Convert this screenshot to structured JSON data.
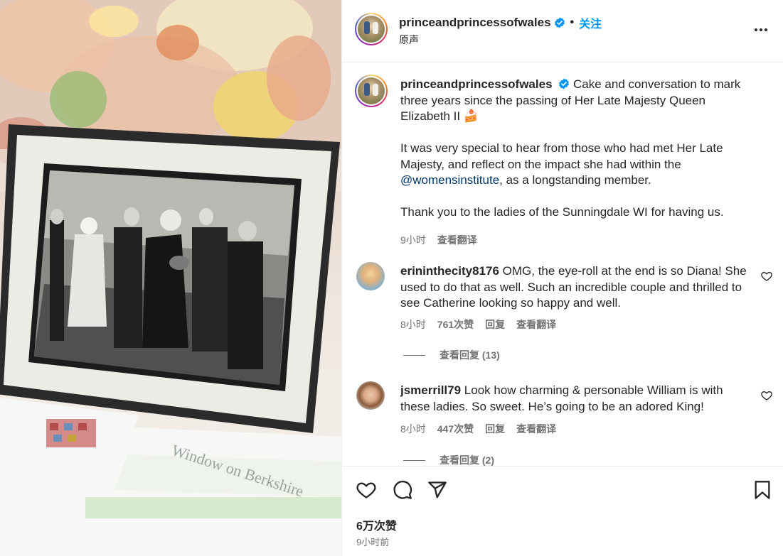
{
  "header": {
    "username": "princeandprincessofwales",
    "separator": "•",
    "follow_label": "关注",
    "subtitle": "原声"
  },
  "caption": {
    "username": "princeandprincessofwales",
    "text_1": "Cake and conversation to mark three years since the passing of Her Late Majesty Queen Elizabeth II 🍰",
    "text_2a": "It was very special to hear from those who had met Her Late Majesty, and reflect on the impact she had within the ",
    "mention": "@womensinstitute",
    "text_2b": ", as a longstanding member.",
    "text_3": "Thank you to the ladies of the Sunningdale WI for having us.",
    "time": "9小时",
    "translate_label": "查看翻译"
  },
  "comments": [
    {
      "username": "erininthecity8176",
      "text": "OMG, the eye-roll at the end is so Diana! She used to do that as well. Such an incredible couple and thrilled to see Catherine looking so happy and well.",
      "time": "8小时",
      "likes": "761次赞",
      "reply_label": "回复",
      "translate_label": "查看翻译",
      "view_replies": "查看回复 (13)"
    },
    {
      "username": "jsmerrill79",
      "text": "Look how charming & personable William is with these ladies. So sweet. He’s going to be an adored King!",
      "time": "8小时",
      "likes": "447次赞",
      "reply_label": "回复",
      "translate_label": "查看翻译",
      "view_replies": "查看回复 (2)"
    }
  ],
  "footer": {
    "likes_count": "6万次赞",
    "time_ago": "9小时前"
  },
  "icons": {
    "verified": "verified-badge-icon",
    "more": "more-options-icon",
    "heart": "heart-icon",
    "comment": "comment-icon",
    "share": "share-icon",
    "save": "bookmark-icon"
  },
  "colors": {
    "accent": "#0095f6",
    "mention": "#00376b",
    "text": "#262626",
    "secondary": "#737373"
  }
}
